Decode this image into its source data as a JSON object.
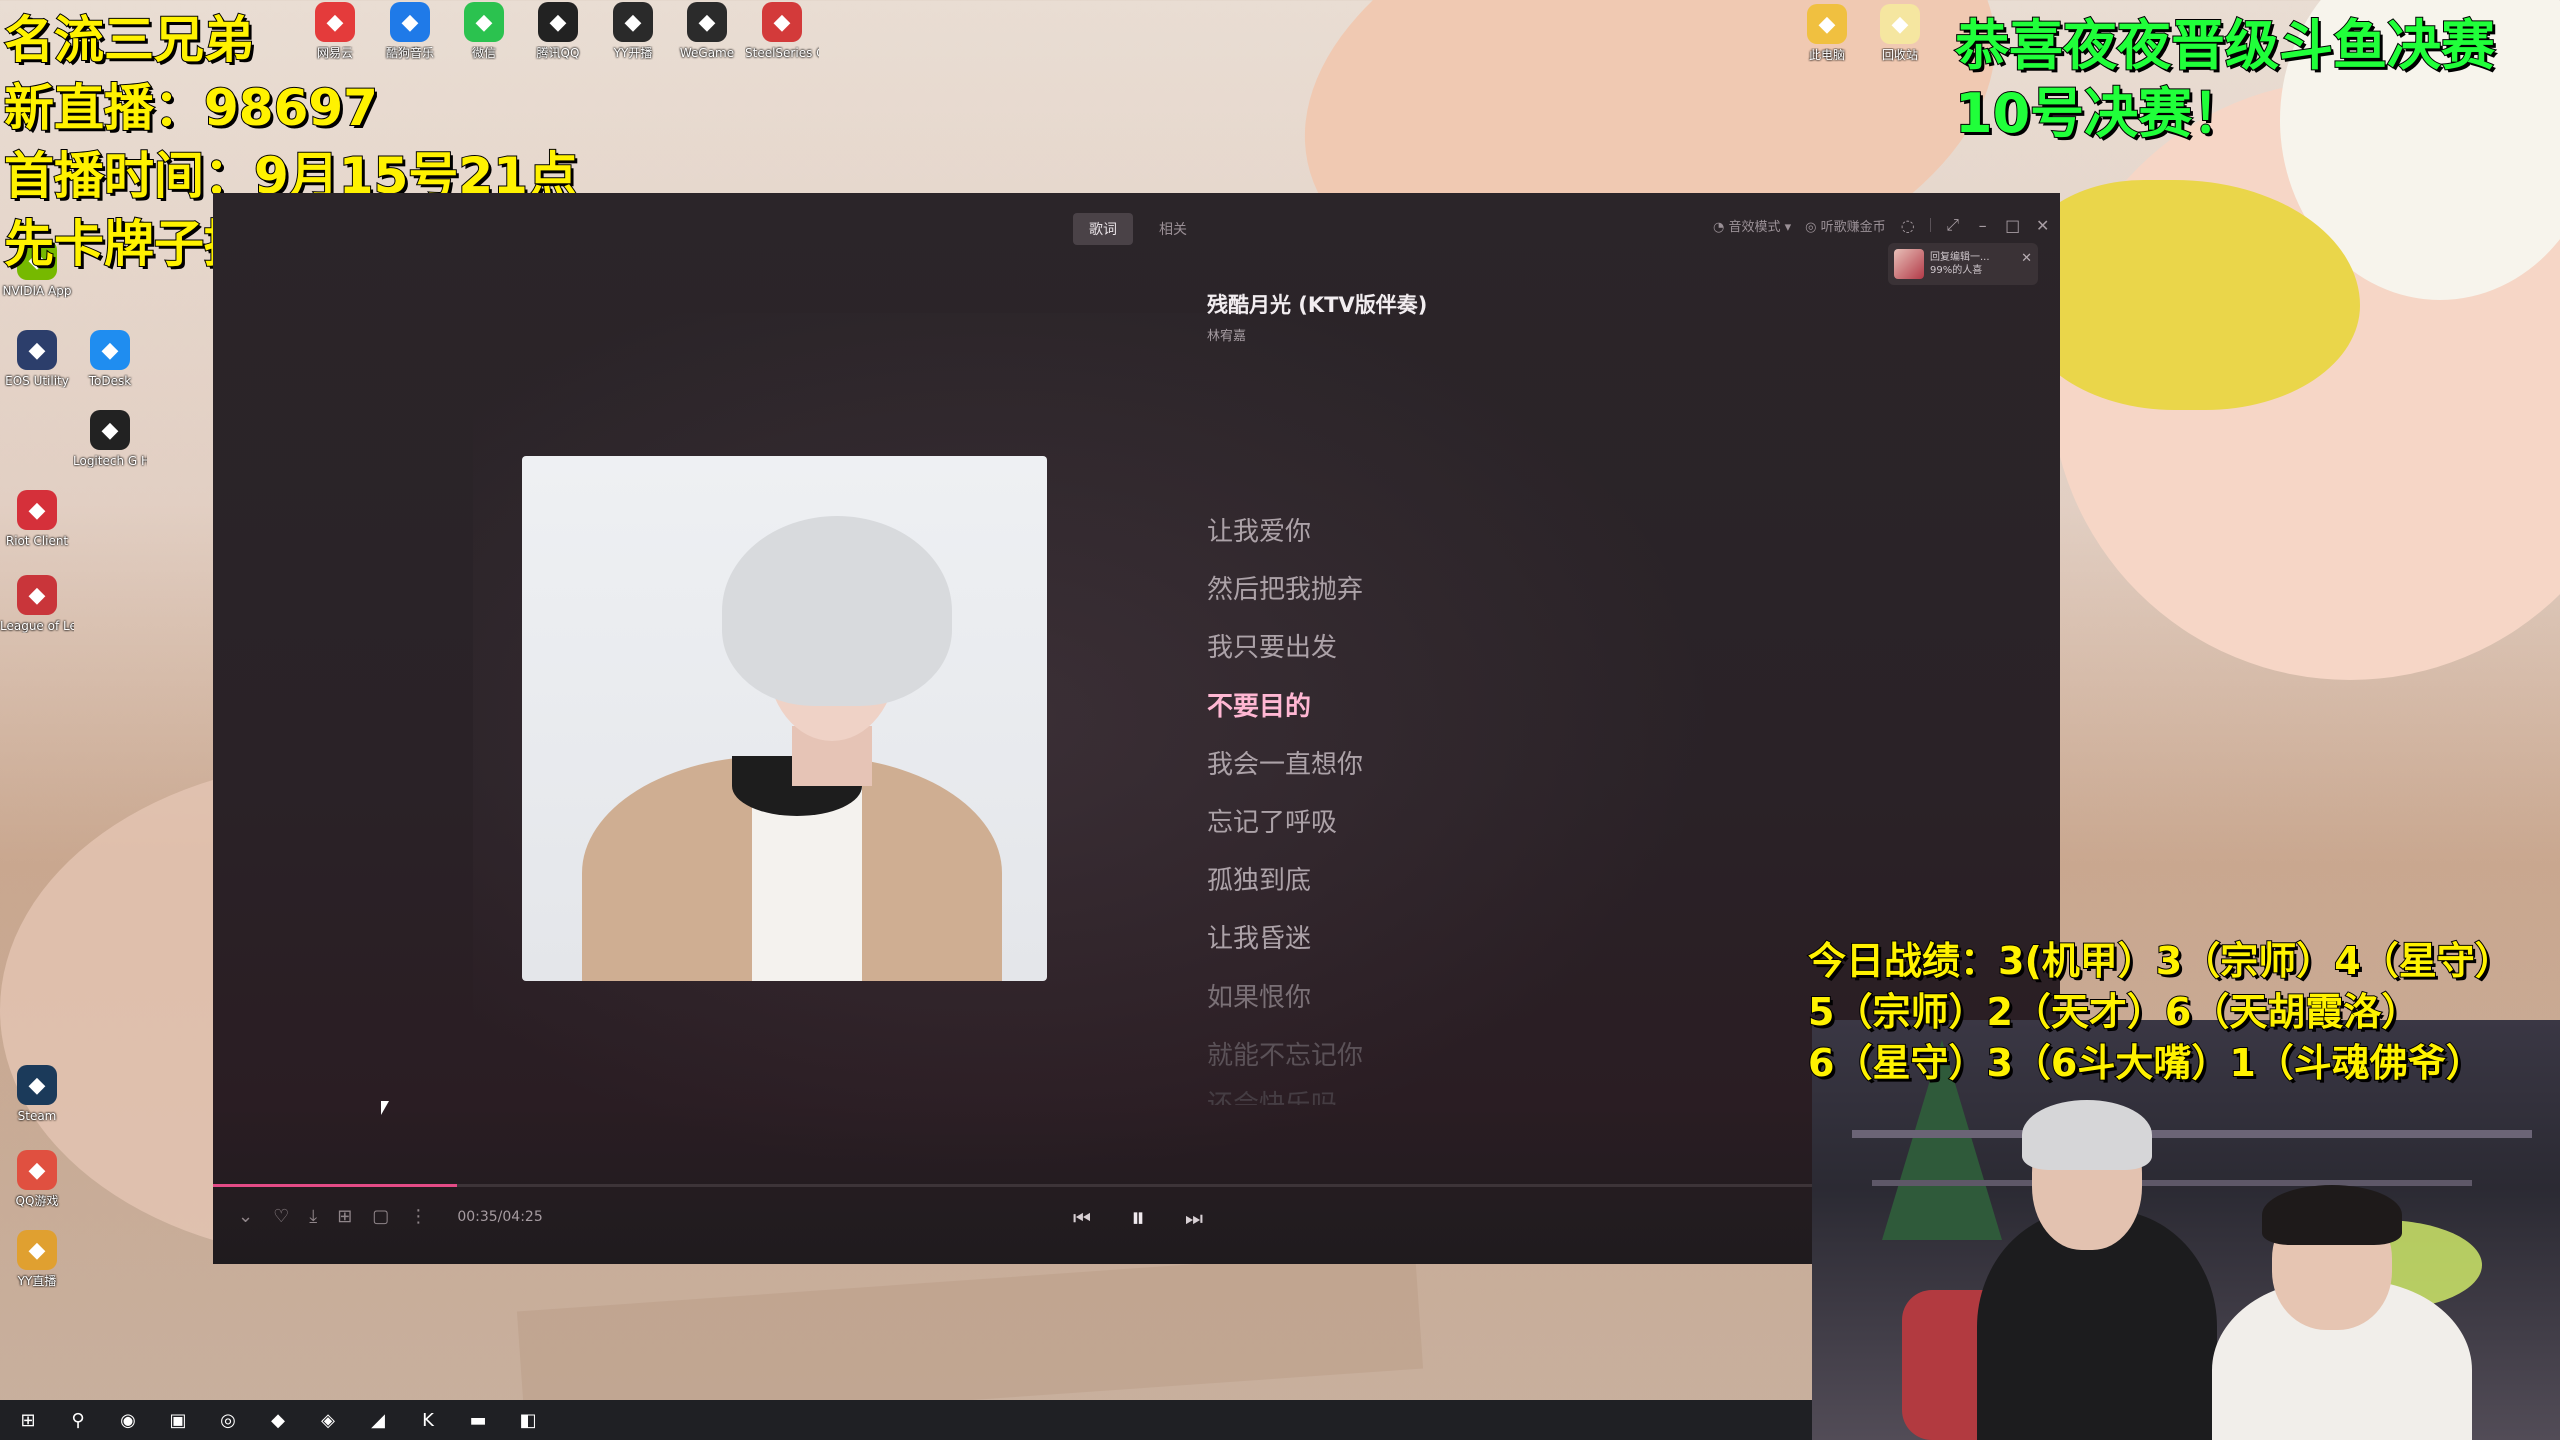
{
  "overlay_left": {
    "lines": [
      "名流三兄弟",
      "新直播：98697",
      "首播时间：9月15号21点",
      "先卡牌子提前上总榜！"
    ]
  },
  "overlay_right": {
    "lines": [
      "恭喜夜夜晋级斗鱼决赛",
      "10号决赛！"
    ]
  },
  "overlay_stats": {
    "lines": [
      "今日战绩：3(机甲）3（宗师）4（星守）",
      "5（宗师）2（天才）6（天胡霞洛）",
      "6（星守）3（6斗大嘴）1（斗魂佛爷）"
    ]
  },
  "desktop_icons_top": [
    {
      "label": "网易云",
      "icon": "netease-music-icon",
      "color": "#e43b3b"
    },
    {
      "label": "酷狗音乐",
      "icon": "kugou-icon",
      "color": "#1f7ae8"
    },
    {
      "label": "微信",
      "icon": "wechat-icon",
      "color": "#2bc24f"
    },
    {
      "label": "腾讯QQ",
      "icon": "qq-icon",
      "color": "#222222"
    },
    {
      "label": "YY开播",
      "icon": "yy-icon",
      "color": "#2a2a2a"
    },
    {
      "label": "WeGame",
      "icon": "wegame-icon",
      "color": "#2b2b2b"
    },
    {
      "label": "SteelSeries GG",
      "icon": "steelseries-icon",
      "color": "#d33a3a"
    }
  ],
  "desktop_icons_left": [
    {
      "label": "NVIDIA App",
      "icon": "nvidia-icon",
      "color": "#76b900"
    },
    {
      "label": "EOS Utility",
      "icon": "eos-utility-icon",
      "color": "#2c3e6b"
    },
    {
      "label": "ToDesk",
      "icon": "todesk-icon",
      "color": "#1f8df0"
    },
    {
      "label": "Logitech G HUB",
      "icon": "logitech-icon",
      "color": "#222222"
    },
    {
      "label": "Riot Client",
      "icon": "riot-icon",
      "color": "#d5303a"
    },
    {
      "label": "League of Legends",
      "icon": "lol-icon",
      "color": "#c9353a"
    },
    {
      "label": "Steam",
      "icon": "steam-icon",
      "color": "#1b3a5a"
    },
    {
      "label": "QQ游戏",
      "icon": "qq-game-icon",
      "color": "#e05040"
    },
    {
      "label": "YY直播",
      "icon": "yy-live-icon",
      "color": "#e0a030"
    }
  ],
  "desktop_icons_right": [
    {
      "label": "此电脑",
      "icon": "pc-icon",
      "color": "#f0c040"
    },
    {
      "label": "回收站",
      "icon": "recycle-icon",
      "color": "#f5e6a0"
    }
  ],
  "player": {
    "tabs": [
      {
        "label": "歌词",
        "active": true
      },
      {
        "label": "相关",
        "active": false
      }
    ],
    "tools": {
      "mode_label": "音效模式",
      "earn_label": "听歌赚金币"
    },
    "notice": {
      "line1": "回复编辑一...",
      "line2": "99%的人喜"
    },
    "song": {
      "title": "残酷月光 (KTV版伴奏)",
      "artist": "林宥嘉"
    },
    "lyrics": [
      {
        "text": "让我爱你",
        "state": "normal"
      },
      {
        "text": "然后把我抛弃",
        "state": "normal"
      },
      {
        "text": "我只要出发",
        "state": "normal"
      },
      {
        "text": "不要目的",
        "state": "current"
      },
      {
        "text": "我会一直想你",
        "state": "normal"
      },
      {
        "text": "忘记了呼吸",
        "state": "normal"
      },
      {
        "text": "孤独到底",
        "state": "normal"
      },
      {
        "text": "让我昏迷",
        "state": "normal"
      },
      {
        "text": "如果恨你",
        "state": "dim1"
      },
      {
        "text": "就能不忘记你",
        "state": "dim2"
      },
      {
        "text": "还会快乐吗",
        "state": "dim3"
      }
    ],
    "playback": {
      "time": "00:35/04:25",
      "progress": 0.132
    },
    "colors": {
      "accent": "#e44b86",
      "current_lyric": "#ffb7d3"
    }
  },
  "taskbar": {
    "items": [
      {
        "icon": "windows-start-icon",
        "glyph": "⊞"
      },
      {
        "icon": "search-icon",
        "glyph": "⚲"
      },
      {
        "icon": "edge-icon",
        "glyph": "◉"
      },
      {
        "icon": "app-icon",
        "glyph": "▣"
      },
      {
        "icon": "chrome-icon",
        "glyph": "◎"
      },
      {
        "icon": "app-icon",
        "glyph": "◆"
      },
      {
        "icon": "app-icon",
        "glyph": "◈"
      },
      {
        "icon": "app-icon",
        "glyph": "◢"
      },
      {
        "icon": "kugou-icon",
        "glyph": "K"
      },
      {
        "icon": "folder-icon",
        "glyph": "▬"
      },
      {
        "icon": "app-icon",
        "glyph": "◧"
      }
    ]
  }
}
